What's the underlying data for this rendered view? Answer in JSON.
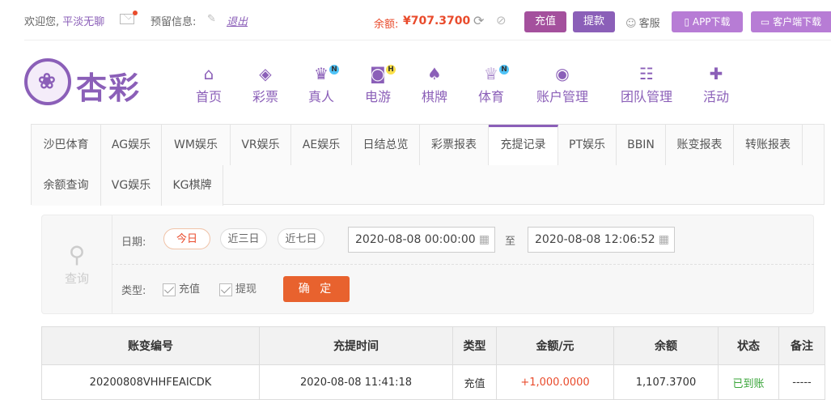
{
  "header": {
    "welcome": "欢迎您,",
    "username": "平淡无聊",
    "reserve_info": "预留信息:",
    "logout": "退出",
    "balance_label": "余额:",
    "balance_value": "¥707.3700",
    "deposit": "充值",
    "withdraw": "提款",
    "customer_service": "客服",
    "app_download": "APP下载",
    "client_download": "客户端下载"
  },
  "logo": {
    "text": "杏彩"
  },
  "nav": [
    {
      "label": "首页",
      "icon": "home-icon",
      "glyph": "⌂"
    },
    {
      "label": "彩票",
      "icon": "lottery-icon",
      "glyph": "◈"
    },
    {
      "label": "真人",
      "icon": "live-dealer-icon",
      "glyph": "♛",
      "badge": "N"
    },
    {
      "label": "电游",
      "icon": "gamepad-icon",
      "glyph": "◙",
      "badge": "H"
    },
    {
      "label": "棋牌",
      "icon": "cards-icon",
      "glyph": "♠"
    },
    {
      "label": "体育",
      "icon": "trophy-icon",
      "glyph": "♕",
      "badge": "N"
    },
    {
      "label": "账户管理",
      "icon": "account-icon",
      "glyph": "◉"
    },
    {
      "label": "团队管理",
      "icon": "team-icon",
      "glyph": "☷"
    },
    {
      "label": "活动",
      "icon": "gift-icon",
      "glyph": "✚"
    }
  ],
  "tabs_row1": [
    "沙巴体育",
    "AG娱乐",
    "WM娱乐",
    "VR娱乐",
    "AE娱乐",
    "日结总览",
    "彩票报表",
    "充提记录",
    "PT娱乐",
    "BBIN",
    "账变报表",
    "转账报表"
  ],
  "tabs_row2": [
    "余额查询",
    "VG娱乐",
    "KG棋牌"
  ],
  "active_tab": "充提记录",
  "filter": {
    "query_label": "查询",
    "date_label": "日期:",
    "ranges": [
      "今日",
      "近三日",
      "近七日"
    ],
    "active_range": "今日",
    "start_date": "2020-08-08 00:00:00",
    "to_label": "至",
    "end_date": "2020-08-08 12:06:52",
    "type_label": "类型:",
    "type_deposit": "充值",
    "type_withdraw": "提现",
    "confirm": "确 定"
  },
  "table": {
    "headers": [
      "账变编号",
      "充提时间",
      "类型",
      "金额/元",
      "余额",
      "状态",
      "备注"
    ],
    "rows": [
      [
        "20200808VHHFEAICDK",
        "2020-08-08 11:41:18",
        "充值",
        "+1,000.0000",
        "1,107.3700",
        "已到账",
        "-----"
      ]
    ]
  },
  "colors": {
    "brand": "#8b5fb8",
    "accent": "#e94b2c",
    "success": "#3aa53a"
  }
}
